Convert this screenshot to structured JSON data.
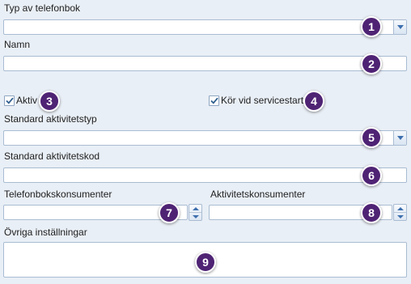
{
  "form": {
    "phonebook_type": {
      "label": "Typ av telefonbok",
      "value": "",
      "badge": "1"
    },
    "name": {
      "label": "Namn",
      "value": "",
      "badge": "2"
    },
    "active": {
      "label": "Aktiv",
      "checked": true,
      "badge": "3"
    },
    "run_on_start": {
      "label": "Kör vid servicestart",
      "checked": true,
      "badge": "4"
    },
    "default_activity_type": {
      "label": "Standard aktivitetstyp",
      "value": "",
      "badge": "5"
    },
    "default_activity_code": {
      "label": "Standard aktivitetskod",
      "value": "",
      "badge": "6"
    },
    "phonebook_consumers": {
      "label": "Telefonbokskonsumenter",
      "value": "",
      "badge": "7"
    },
    "activity_consumers": {
      "label": "Aktivitetskonsumenter",
      "value": "",
      "badge": "8"
    },
    "other_settings": {
      "label": "Övriga inställningar",
      "value": "",
      "badge": "9"
    }
  },
  "colors": {
    "badge": "#4f2374",
    "accent": "#3d6fae",
    "background": "#e9eff6",
    "border": "#a9bcd3"
  },
  "icons": {
    "dropdown": "chevron-down-icon",
    "checkbox": "checkmark-icon",
    "spinner": "spin-arrows-icon"
  }
}
